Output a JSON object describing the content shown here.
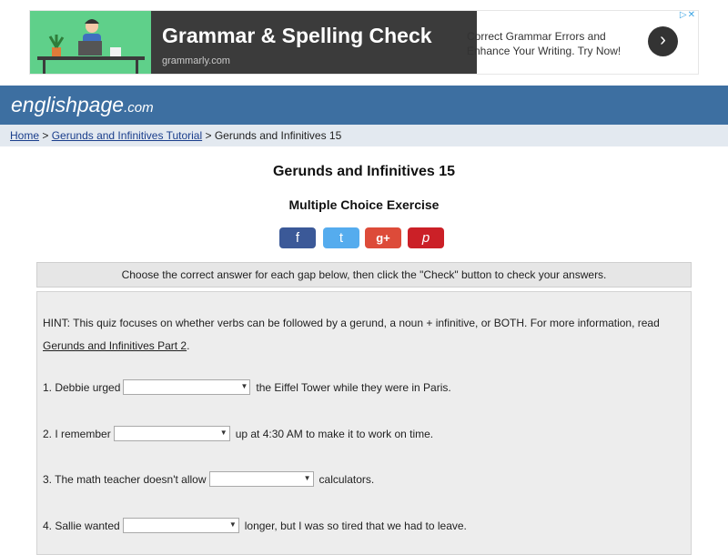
{
  "ad": {
    "headline": "Grammar & Spelling Check",
    "domain": "grammarly.com",
    "copy": "Correct Grammar Errors and Enhance Your Writing. Try Now!",
    "arrow": "›",
    "choices": "▷✕",
    "illustration_icon": "person-at-laptop-illustration"
  },
  "site": {
    "logo": "englishpage",
    "logo_suffix": ".com",
    "brand_color": "#3d6fa1"
  },
  "breadcrumb": {
    "home": "Home",
    "separator": ">",
    "tutorial": "Gerunds and Infinitives Tutorial",
    "current": "Gerunds and Infinitives 15"
  },
  "page": {
    "title": "Gerunds and Infinitives 15",
    "subtitle": "Multiple Choice Exercise"
  },
  "share": {
    "facebook": "f",
    "twitter": "t",
    "googleplus": "g+",
    "pinterest": "p"
  },
  "instructions": "Choose the correct answer for each gap below, then click the \"Check\" button to check your answers.",
  "hint": {
    "text": "HINT: This quiz focuses on whether verbs can be followed by a gerund, a noun + infinitive, or BOTH. For more information, read",
    "link": "Gerunds and Infinitives Part 2",
    "end": "."
  },
  "questions": [
    {
      "before": "1. Debbie urged",
      "after": "the Eiffel Tower while they were in Paris.",
      "selected": ""
    },
    {
      "before": "2. I remember",
      "after": "up at 4:30 AM to make it to work on time.",
      "selected": ""
    },
    {
      "before": "3. The math teacher doesn't allow",
      "after": "calculators.",
      "selected": ""
    },
    {
      "before": "4. Sallie wanted",
      "after": "longer, but I was so tired that we had to leave.",
      "selected": ""
    }
  ]
}
